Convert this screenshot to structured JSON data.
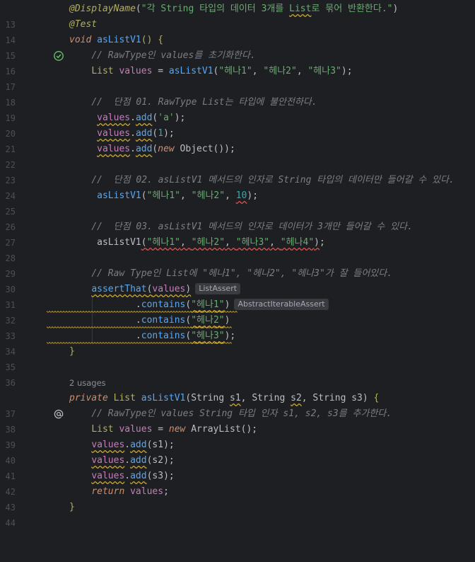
{
  "editor": {
    "lines": [
      {
        "n": "13"
      },
      {
        "n": "14"
      },
      {
        "n": "15"
      },
      {
        "n": "16"
      },
      {
        "n": "17"
      },
      {
        "n": "18"
      },
      {
        "n": "19"
      },
      {
        "n": "20"
      },
      {
        "n": "21"
      },
      {
        "n": "22"
      },
      {
        "n": "23"
      },
      {
        "n": "24"
      },
      {
        "n": "25"
      },
      {
        "n": "26"
      },
      {
        "n": "27"
      },
      {
        "n": "28"
      },
      {
        "n": "29"
      },
      {
        "n": "30"
      },
      {
        "n": "31"
      },
      {
        "n": "32"
      },
      {
        "n": "33"
      },
      {
        "n": "34"
      },
      {
        "n": "35"
      },
      {
        "n": "36"
      },
      {
        "n": "37"
      },
      {
        "n": "38"
      },
      {
        "n": "39"
      },
      {
        "n": "40"
      },
      {
        "n": "41"
      },
      {
        "n": "42"
      },
      {
        "n": "43"
      },
      {
        "n": "44"
      }
    ],
    "usages_label": "2 usages",
    "hints": {
      "list_assert": "ListAssert",
      "abstract_iterable_assert": "AbstractIterableAssert"
    },
    "gutter_icons": {
      "run_test": "run-test-icon",
      "implementation": "at-sign-icon"
    },
    "colors": {
      "background": "#1e1f22",
      "keyword": "#cf8e6d",
      "string": "#6aab73",
      "function": "#56a8f5",
      "number": "#2aacb8",
      "annotation": "#b3ae60",
      "comment": "#7a7e85",
      "warning": "#c9a630",
      "error": "#d8534e"
    }
  }
}
